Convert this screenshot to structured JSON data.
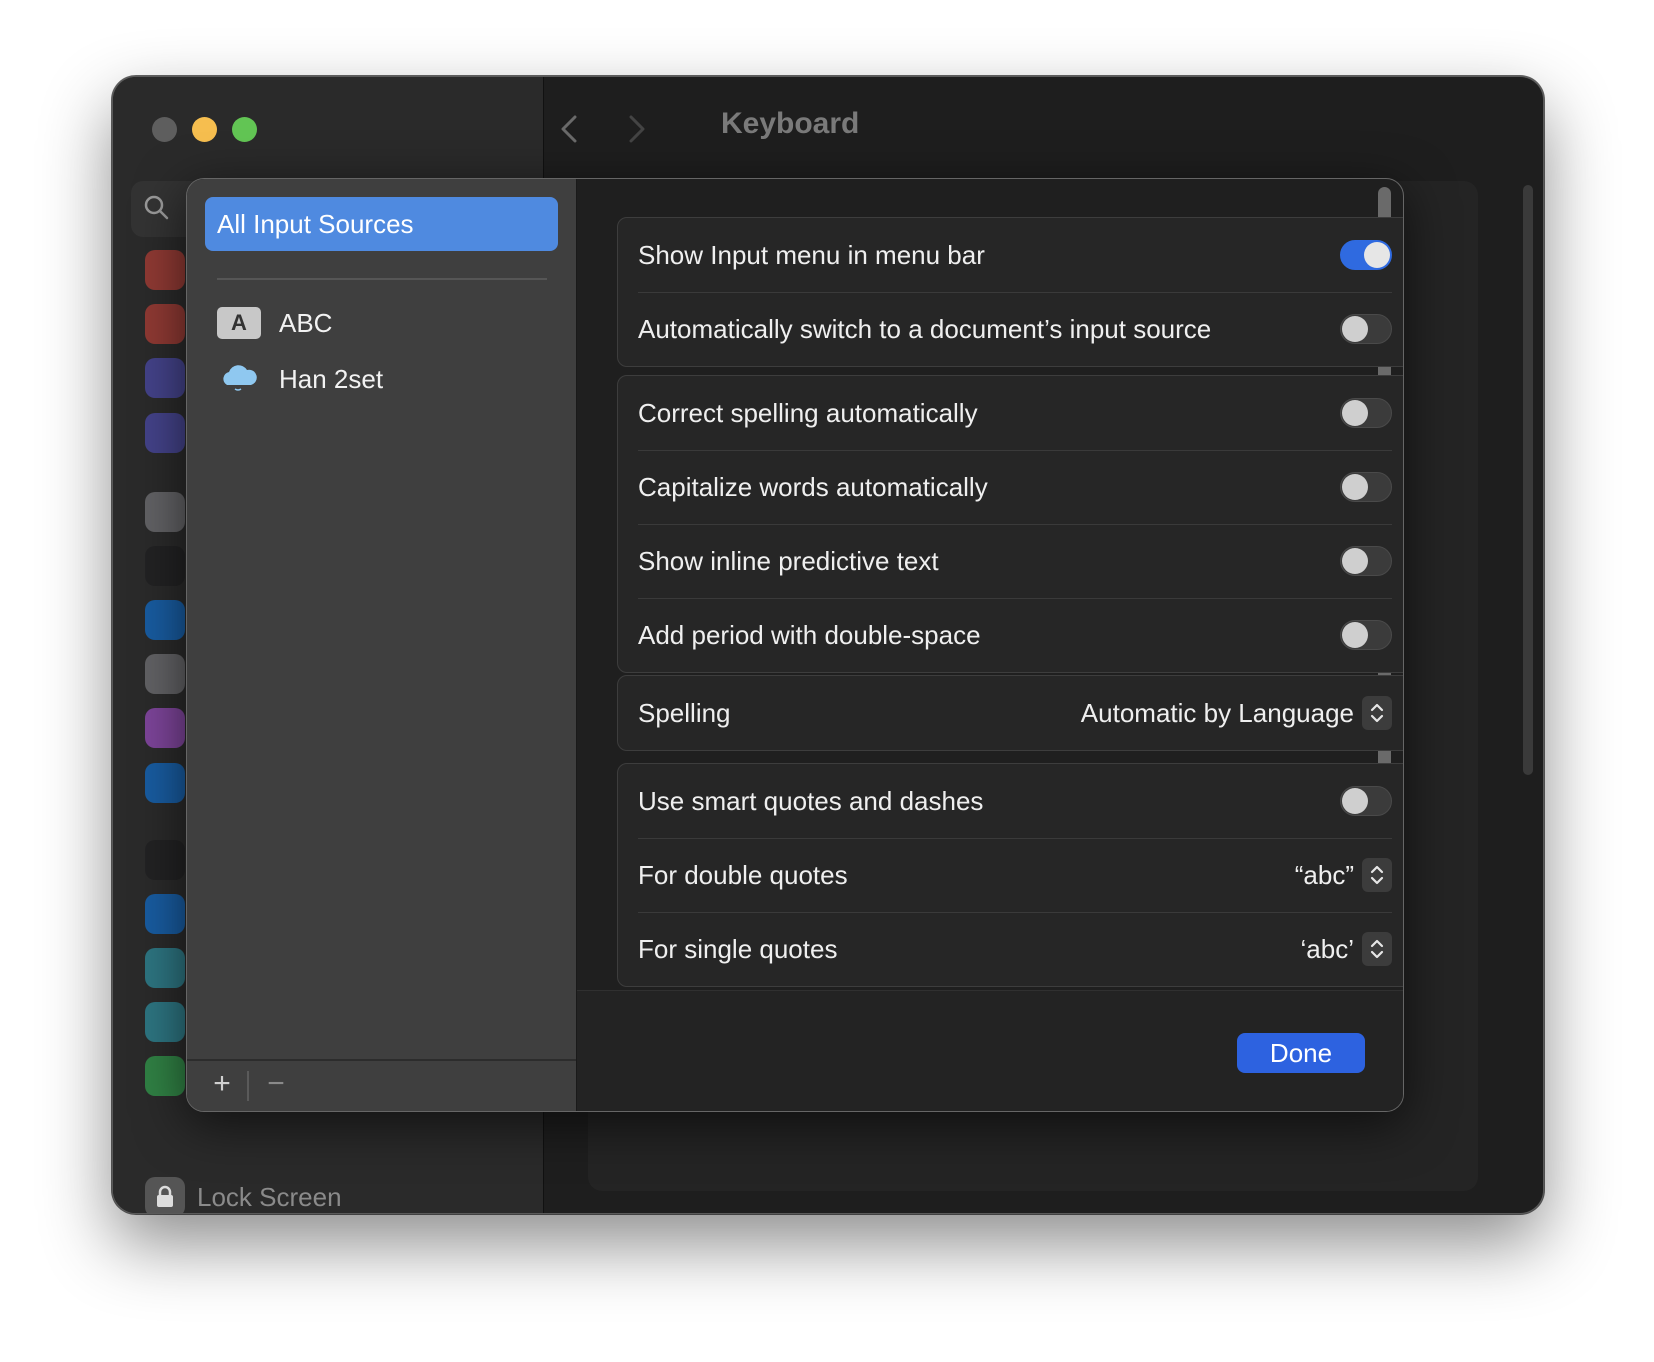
{
  "window": {
    "title": "Keyboard",
    "lock_screen_label": "Lock Screen"
  },
  "sidebar_icons": [
    {
      "name": "notifications-icon",
      "color": "#e0453a"
    },
    {
      "name": "sound-icon",
      "color": "#e0453a"
    },
    {
      "name": "focus-icon",
      "color": "#5856d6"
    },
    {
      "name": "screen-time-icon",
      "color": "#5856d6"
    },
    {
      "name": "general-icon",
      "color": "#8e8e93"
    },
    {
      "name": "appearance-icon",
      "color": "#1c1c1e"
    },
    {
      "name": "accessibility-icon",
      "color": "#0a84ff"
    },
    {
      "name": "control-center-icon",
      "color": "#8e8e93"
    },
    {
      "name": "siri-icon",
      "color": "#bf5af2"
    },
    {
      "name": "privacy-icon",
      "color": "#0a84ff"
    },
    {
      "name": "desktop-dock-icon",
      "color": "#1c1c1e"
    },
    {
      "name": "displays-icon",
      "color": "#0a84ff"
    },
    {
      "name": "wallpaper-icon",
      "color": "#30b0c7"
    },
    {
      "name": "screen-saver-icon",
      "color": "#30b0c7"
    },
    {
      "name": "battery-icon",
      "color": "#34c759"
    }
  ],
  "sheet": {
    "sources_header": "All Input Sources",
    "sources": [
      {
        "label": "ABC",
        "badge": "A",
        "icon": "abc-badge-icon"
      },
      {
        "label": "Han 2set",
        "icon": "cloud-icon"
      }
    ],
    "add_label": "+",
    "remove_label": "−",
    "groups": [
      {
        "rows": [
          {
            "label": "Show Input menu in menu bar",
            "toggle": true
          },
          {
            "label": "Automatically switch to a document’s input source",
            "toggle": false
          }
        ]
      },
      {
        "rows": [
          {
            "label": "Correct spelling automatically",
            "toggle": false
          },
          {
            "label": "Capitalize words automatically",
            "toggle": false
          },
          {
            "label": "Show inline predictive text",
            "toggle": false
          },
          {
            "label": "Add period with double-space",
            "toggle": false
          }
        ]
      },
      {
        "rows": [
          {
            "label": "Spelling",
            "value": "Automatic by Language"
          }
        ]
      },
      {
        "rows": [
          {
            "label": "Use smart quotes and dashes",
            "toggle": false
          },
          {
            "label": "For double quotes",
            "value": "“abc”"
          },
          {
            "label": "For single quotes",
            "value": "‘abc’"
          }
        ]
      }
    ],
    "done_label": "Done"
  },
  "colors": {
    "accent": "#2d62e0",
    "selection": "#4f8ae0",
    "toggle_on": "#2f6ae0"
  }
}
